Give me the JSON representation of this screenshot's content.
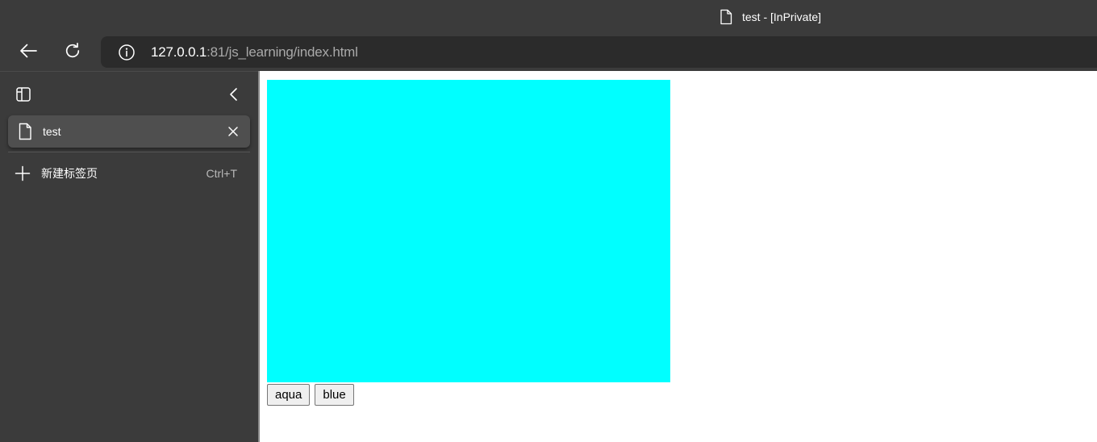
{
  "window": {
    "title": "test - [InPrivate]",
    "title_icon": "document-icon"
  },
  "toolbar": {
    "back_icon": "back-arrow-icon",
    "refresh_icon": "refresh-icon",
    "address": {
      "info_icon": "info-icon",
      "host": "127.0.0.1",
      "rest": ":81/js_learning/index.html"
    }
  },
  "sidebar": {
    "tabs": [
      {
        "label": "test",
        "icon": "document-icon",
        "close_icon": "close-icon"
      }
    ],
    "new_tab": {
      "label": "新建标签页",
      "shortcut": "Ctrl+T",
      "icon": "plus-icon"
    }
  },
  "page": {
    "box_color": "#00ffff",
    "buttons": [
      {
        "label": "aqua"
      },
      {
        "label": "blue"
      }
    ]
  },
  "colors": {
    "chrome_bg": "#3b3b3b",
    "address_bg": "#2b2b2b",
    "tab_bg": "#4f4f4f",
    "content_bg": "#ffffff"
  }
}
